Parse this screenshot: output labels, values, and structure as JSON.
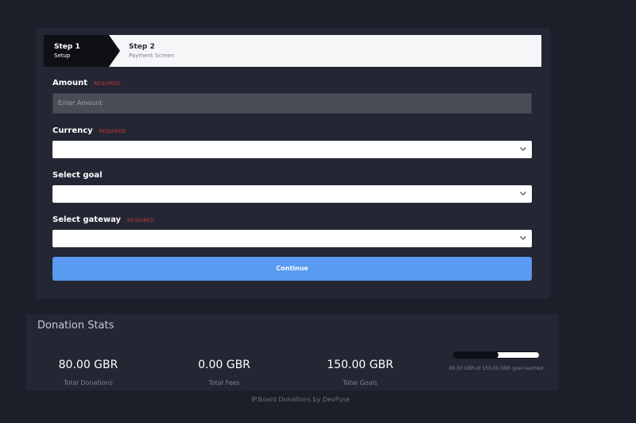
{
  "stepper": {
    "steps": [
      {
        "title": "Step 1",
        "subtitle": "Setup"
      },
      {
        "title": "Step 2",
        "subtitle": "Payment Screen"
      }
    ]
  },
  "form": {
    "amount": {
      "label": "Amount",
      "required": "REQUIRED",
      "placeholder": "Enter Amount",
      "value": ""
    },
    "currency": {
      "label": "Currency",
      "required": "REQUIRED",
      "value": ""
    },
    "goal": {
      "label": "Select goal",
      "value": ""
    },
    "gateway": {
      "label": "Select gateway",
      "required": "REQUIRED",
      "value": ""
    },
    "continue_label": "Continue"
  },
  "stats": {
    "title": "Donation Stats",
    "items": [
      {
        "value": "80.00 GBR",
        "label": "Total Donations"
      },
      {
        "value": "0.00 GBR",
        "label": "Total Fees"
      },
      {
        "value": "150.00 GBR",
        "label": "Total Goals"
      }
    ],
    "goal_progress": 0.53,
    "goal_caption": "80.00 GBR of 150.00 GBR goal reached."
  },
  "footer": {
    "text": "IP.Board Donations by DevFuse"
  },
  "colors": {
    "background": "#1c1e2a",
    "card": "#242634",
    "accent_button": "#5a9af0",
    "required_red": "#d13a3a",
    "step_active": "#0f1016"
  },
  "icons": {
    "select_chevron": "chevron-down-icon"
  }
}
